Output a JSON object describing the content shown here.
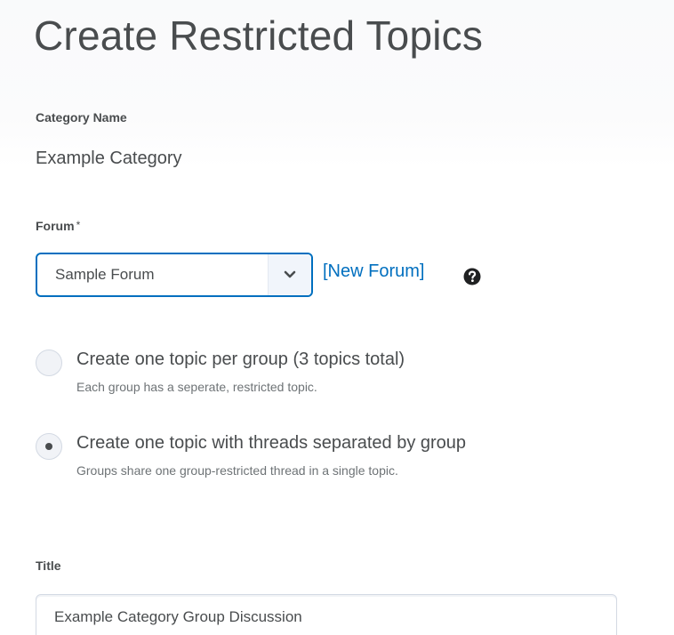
{
  "page": {
    "title": "Create Restricted Topics"
  },
  "category": {
    "label": "Category Name",
    "value": "Example Category"
  },
  "forum": {
    "label": "Forum",
    "required_mark": "*",
    "selected": "Sample Forum",
    "new_forum_link": "[New Forum]",
    "help_icon": "question-circle-icon"
  },
  "topic_options": [
    {
      "label": "Create one topic per group (3 topics total)",
      "description": "Each group has a seperate, restricted topic.",
      "checked": false
    },
    {
      "label": "Create one topic with threads separated by group",
      "description": "Groups share one group-restricted thread in a single topic.",
      "checked": true
    }
  ],
  "title_field": {
    "label": "Title",
    "value": "Example Category Group Discussion"
  },
  "colors": {
    "accent": "#006fbf",
    "text": "#494c4e",
    "muted_text": "#6e7376",
    "border": "#d3d9e3"
  }
}
